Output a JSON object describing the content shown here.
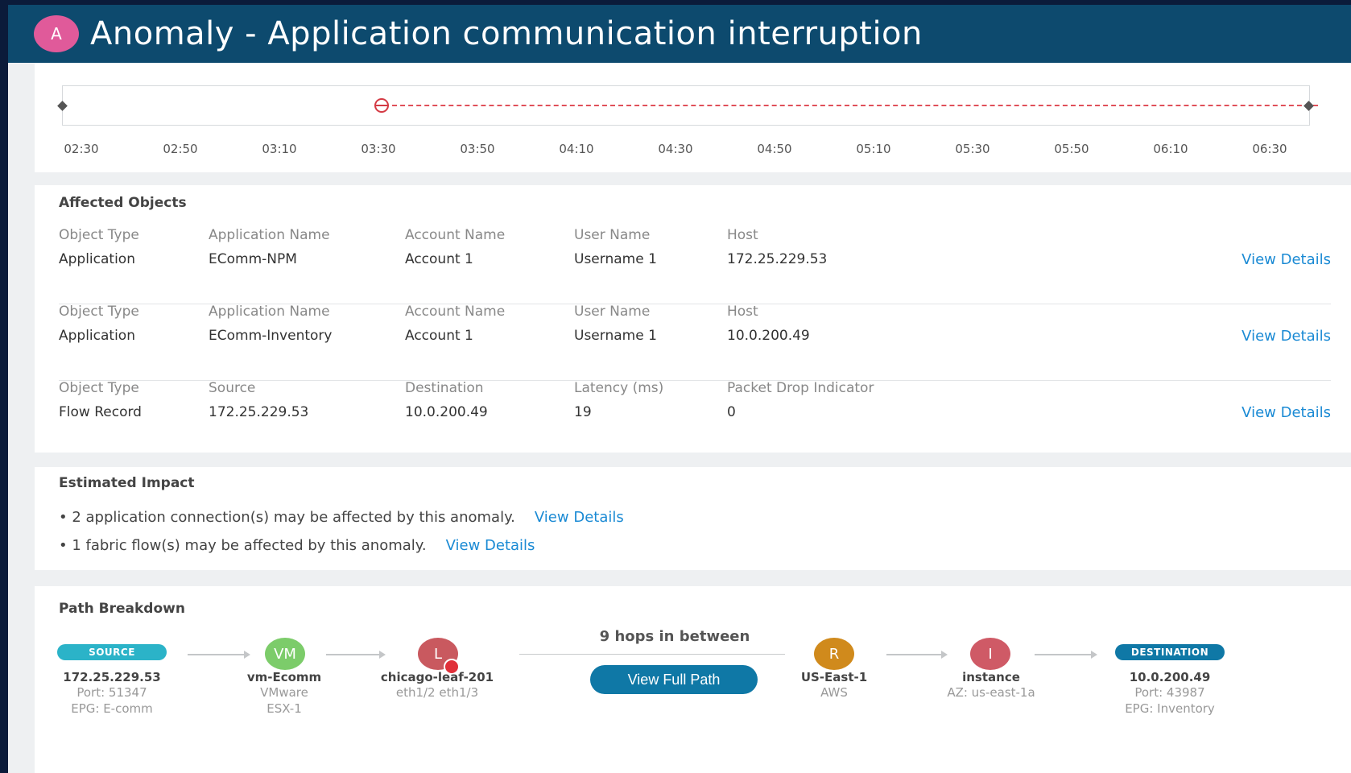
{
  "header": {
    "avatar_letter": "A",
    "title": "Anomaly - Application communication interruption"
  },
  "timeline": {
    "ticks": [
      "02:30",
      "02:50",
      "03:10",
      "03:30",
      "03:50",
      "04:10",
      "04:30",
      "04:50",
      "05:10",
      "05:30",
      "05:50",
      "06:10",
      "06:30"
    ]
  },
  "affected": {
    "title": "Affected Objects",
    "rows": [
      {
        "labels": [
          "Object Type",
          "Application Name",
          "Account Name",
          "User Name",
          "Host"
        ],
        "values": [
          "Application",
          "EComm-NPM",
          "Account 1",
          "Username 1",
          "172.25.229.53"
        ],
        "link": "View Details"
      },
      {
        "labels": [
          "Object Type",
          "Application Name",
          "Account Name",
          "User Name",
          "Host"
        ],
        "values": [
          "Application",
          "EComm-Inventory",
          "Account 1",
          "Username 1",
          "10.0.200.49"
        ],
        "link": "View Details"
      },
      {
        "labels": [
          "Object Type",
          "Source",
          "Destination",
          "Latency (ms)",
          "Packet Drop Indicator"
        ],
        "values": [
          "Flow Record",
          "172.25.229.53",
          "10.0.200.49",
          "19",
          "0"
        ],
        "link": "View Details"
      }
    ]
  },
  "impact": {
    "title": "Estimated Impact",
    "lines": [
      {
        "text": "• 2 application connection(s) may be affected by this anomaly.",
        "link": "View Details"
      },
      {
        "text": "• 1 fabric flow(s) may be affected by this anomaly.",
        "link": "View Details"
      }
    ]
  },
  "path": {
    "title": "Path Breakdown",
    "hops_label": "9 hops in between",
    "view_full_path": "View Full Path",
    "source": {
      "badge": "SOURCE",
      "name": "172.25.229.53",
      "line2": "Port: 51347",
      "line3": "EPG: E-comm"
    },
    "vm": {
      "letter": "VM",
      "name": "vm-Ecomm",
      "line2": "VMware",
      "line3": "ESX-1",
      "color": "#7ccc6a"
    },
    "leaf": {
      "letter": "L",
      "name": "chicago-leaf-201",
      "line2": "eth1/2 eth1/3",
      "color": "#c9595f"
    },
    "region": {
      "letter": "R",
      "name": "US-East-1",
      "line2": "AWS",
      "color": "#d08a1c"
    },
    "instance": {
      "letter": "I",
      "name": "instance",
      "line2": "AZ: us-east-1a",
      "color": "#cf5a66"
    },
    "destination": {
      "badge": "DESTINATION",
      "name": "10.0.200.49",
      "line2": "Port: 43987",
      "line3": "EPG: Inventory"
    }
  }
}
